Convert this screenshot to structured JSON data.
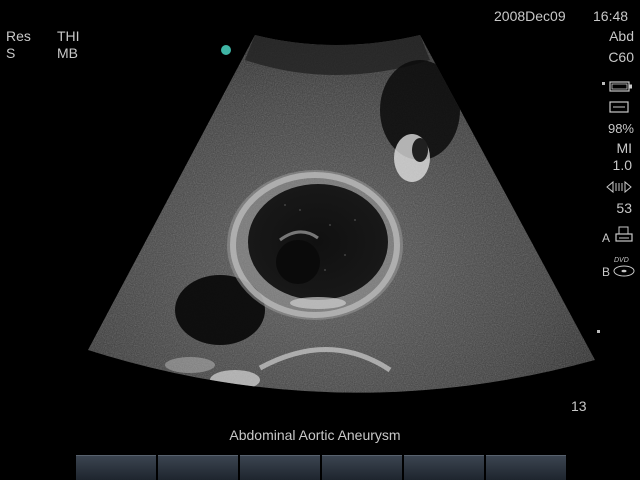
{
  "header": {
    "mode_res": "Res",
    "mode_thi": "THI",
    "mode_s": "S",
    "mode_mb": "MB",
    "date": "2008Dec09",
    "time": "16:48"
  },
  "sidebar": {
    "preset": "Abd",
    "transducer": "C60",
    "battery_pct": "98%",
    "mi_label": "MI",
    "mi_value": "1.0",
    "gain": "53",
    "print_a_label": "A",
    "record_b_label": "B",
    "dvd_label": "DVD"
  },
  "depth_value": "13",
  "caption": "Abdominal Aortic Aneurysm",
  "softkeys_count": 6,
  "colors": {
    "text": "#c8c8c8",
    "orientation_marker": "#3fb5a5",
    "background": "#000000"
  }
}
